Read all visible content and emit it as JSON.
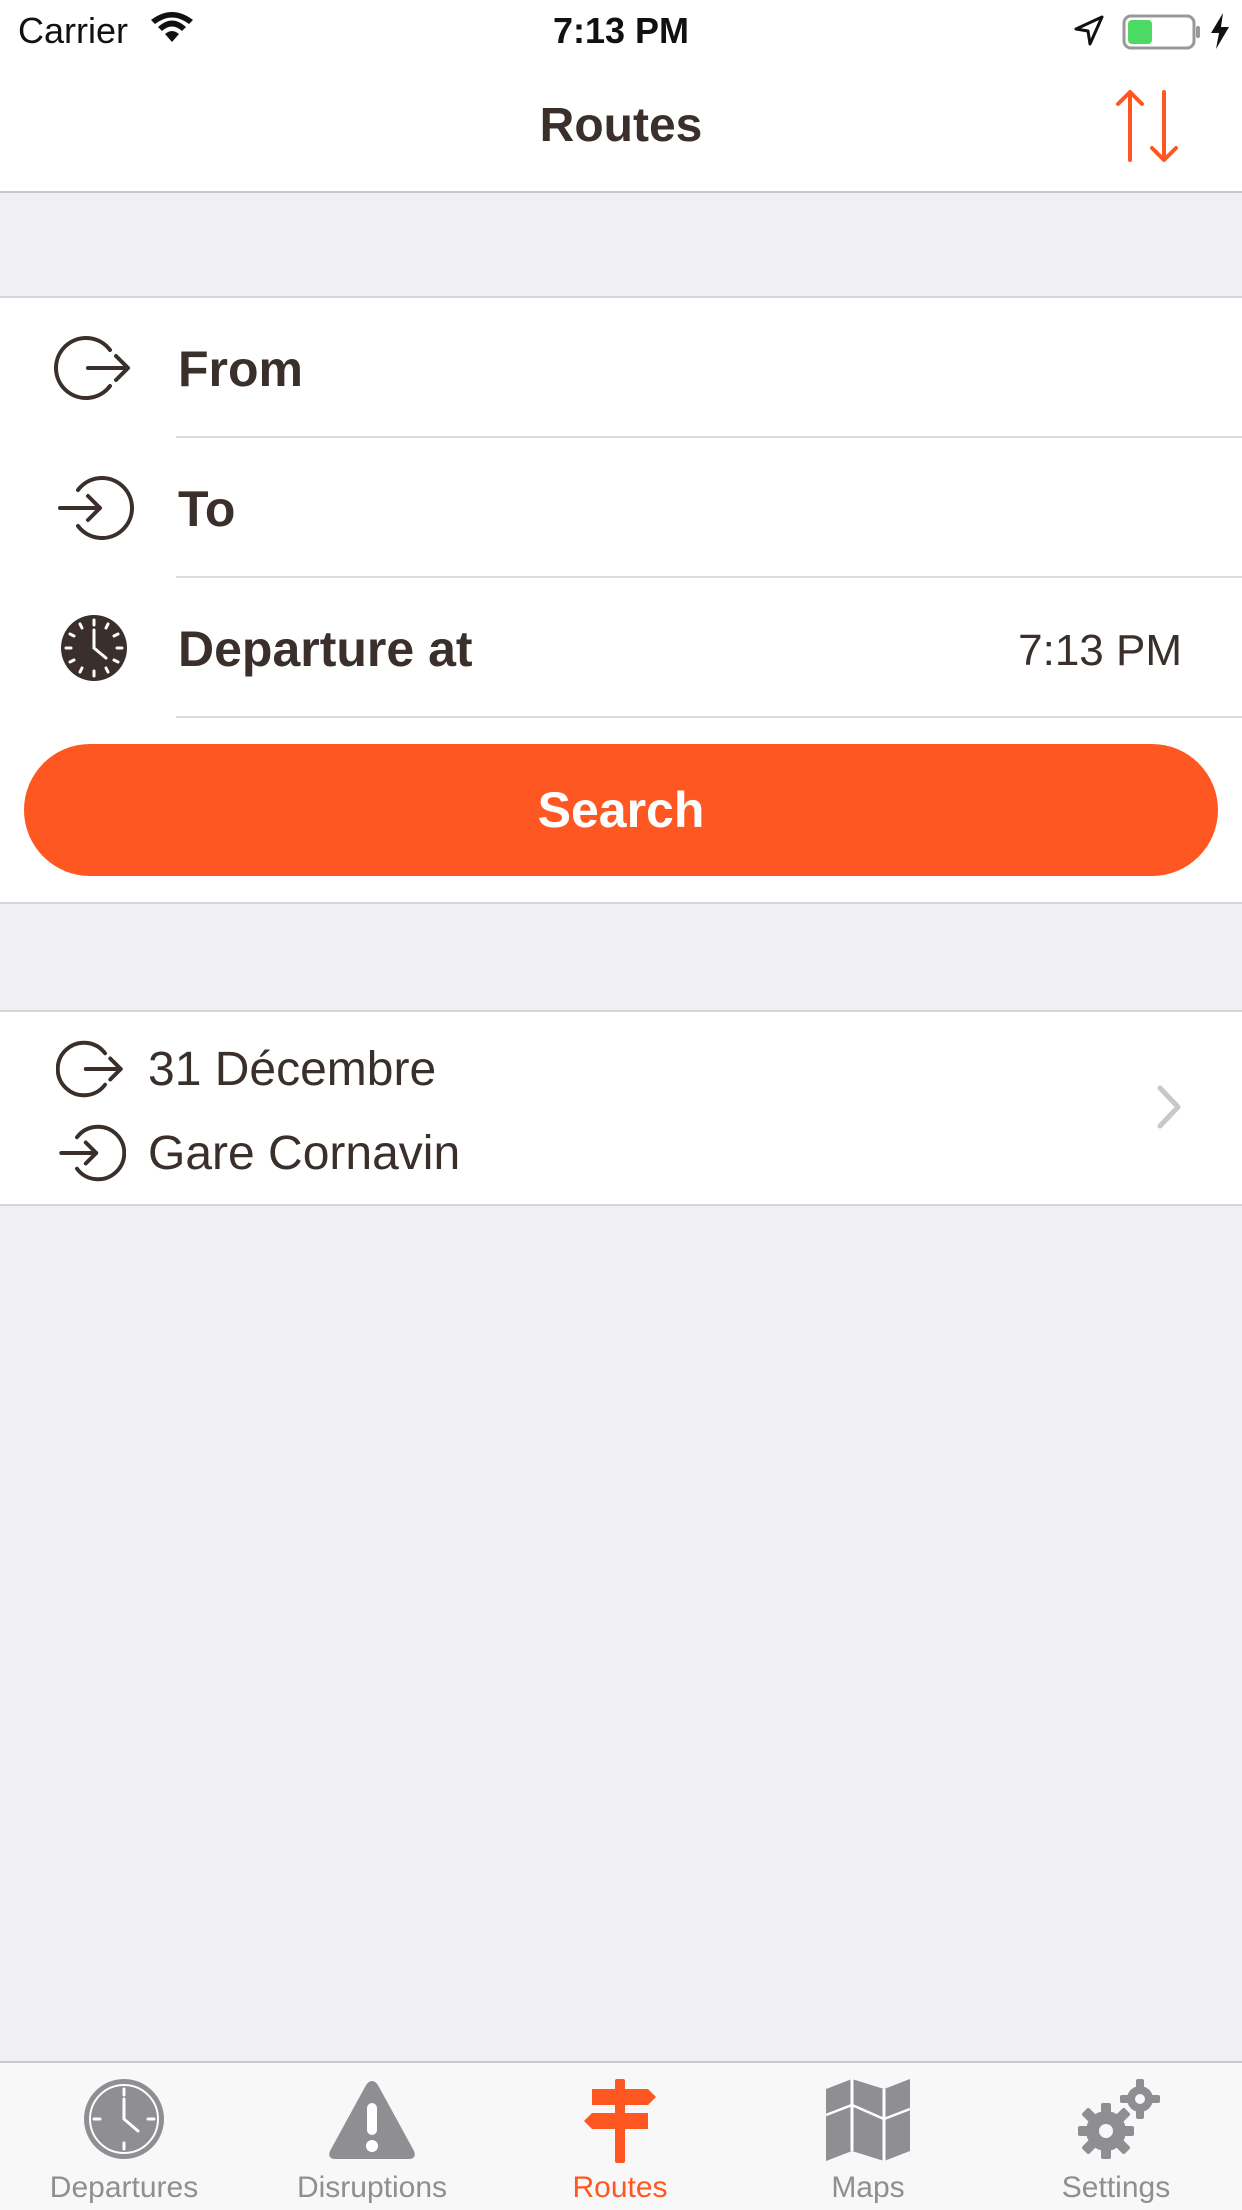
{
  "status_bar": {
    "carrier": "Carrier",
    "time": "7:13 PM"
  },
  "nav": {
    "title": "Routes",
    "swap_icon": "swap-vertical-arrows-icon"
  },
  "form": {
    "from_label": "From",
    "to_label": "To",
    "departure_label": "Departure at",
    "departure_time": "7:13 PM",
    "search_label": "Search"
  },
  "recent": {
    "from": "31 Décembre",
    "to": "Gare Cornavin"
  },
  "tabs": [
    {
      "label": "Departures",
      "icon": "clock-icon",
      "active": false
    },
    {
      "label": "Disruptions",
      "icon": "warning-icon",
      "active": false
    },
    {
      "label": "Routes",
      "icon": "signpost-icon",
      "active": true
    },
    {
      "label": "Maps",
      "icon": "map-icon",
      "active": false
    },
    {
      "label": "Settings",
      "icon": "gears-icon",
      "active": false
    }
  ],
  "colors": {
    "accent": "#ff5722",
    "text": "#3b2f2c",
    "background": "#efeff4",
    "tab_inactive": "#8e8e93"
  }
}
